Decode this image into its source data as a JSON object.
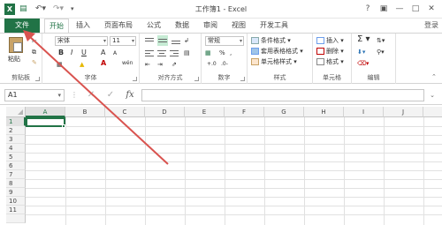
{
  "window": {
    "title": "工作簿1 - Excel",
    "logo": "X",
    "help": "?",
    "login": "登录"
  },
  "tabs": {
    "file": "文件",
    "items": [
      "开始",
      "插入",
      "页面布局",
      "公式",
      "数据",
      "审阅",
      "视图",
      "开发工具"
    ],
    "active": "开始"
  },
  "ribbon": {
    "clipboard": {
      "paste": "粘贴",
      "label": "剪贴板"
    },
    "font": {
      "name": "宋体",
      "size": "11",
      "bold": "B",
      "italic": "I",
      "underline": "U",
      "grow": "A",
      "shrink": "A",
      "font_color": "A",
      "phonetic": "wén",
      "label": "字体"
    },
    "alignment": {
      "label": "对齐方式"
    },
    "number": {
      "format": "常规",
      "percent": "%",
      "comma": ",",
      "label": "数字"
    },
    "styles": {
      "conditional": "条件格式",
      "table_format": "套用表格格式",
      "cell_styles": "单元格样式",
      "label": "样式"
    },
    "cells": {
      "insert": "插入",
      "delete": "删除",
      "format": "格式",
      "label": "单元格"
    },
    "editing": {
      "sum": "Σ",
      "label": "编辑"
    }
  },
  "formula_bar": {
    "name_box": "A1",
    "cancel": "✕",
    "enter": "✓",
    "fx": "fx",
    "content": ""
  },
  "grid": {
    "columns": [
      "A",
      "B",
      "C",
      "D",
      "E",
      "F",
      "G",
      "H",
      "I",
      "J"
    ],
    "rows": [
      "1",
      "2",
      "3",
      "4",
      "5",
      "6",
      "7",
      "8",
      "9",
      "10",
      "11"
    ],
    "active_cell": "A1"
  },
  "colors": {
    "accent": "#217346",
    "arrow": "#d9534f"
  }
}
